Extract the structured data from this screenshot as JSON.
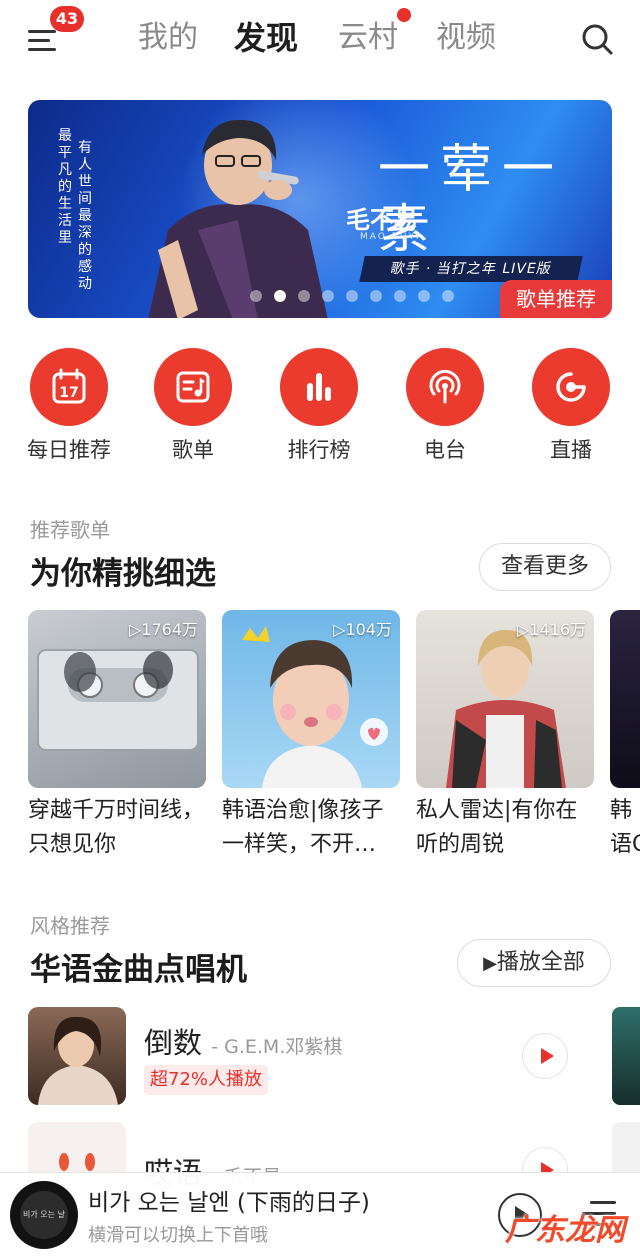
{
  "header": {
    "notification_count": "43",
    "tabs": [
      {
        "label": "我的",
        "active": false
      },
      {
        "label": "发现",
        "active": true
      },
      {
        "label": "云村",
        "active": false,
        "has_dot": true
      },
      {
        "label": "视频",
        "active": false
      }
    ],
    "icons": {
      "menu": "hamburger-icon",
      "search": "search-icon"
    }
  },
  "banner": {
    "vertical_text_1": "最平凡的生活里",
    "vertical_text_2": "有人世间最深的感动",
    "title": "一荤一素",
    "artist": "毛不易",
    "artist_en": "MAO BUYI",
    "subtitle": "歌手 · 当打之年 LIVE版",
    "tag": "歌单推荐",
    "page_count": 9,
    "current_page": 1
  },
  "quick_entries": [
    {
      "label": "每日推荐",
      "icon": "calendar-icon",
      "calendar_day": "17"
    },
    {
      "label": "歌单",
      "icon": "playlist-icon"
    },
    {
      "label": "排行榜",
      "icon": "chart-bars-icon"
    },
    {
      "label": "电台",
      "icon": "radio-icon"
    },
    {
      "label": "直播",
      "icon": "live-icon"
    }
  ],
  "recommend": {
    "subtitle": "推荐歌单",
    "title": "为你精挑细选",
    "more_label": "查看更多",
    "playlists": [
      {
        "plays": "▷1764万",
        "title": "穿越千万时间线，只想见你"
      },
      {
        "plays": "▷104万",
        "title": "韩语治愈|像孩子一样笑，不开…"
      },
      {
        "plays": "▷1416万",
        "title": "私人雷达|有你在听的周锐"
      },
      {
        "plays": "",
        "title": "韩语CU"
      }
    ]
  },
  "style": {
    "subtitle": "风格推荐",
    "title": "华语金曲点唱机",
    "play_all_label": "播放全部",
    "songs": [
      {
        "name": "倒数",
        "artist": "- G.E.M.邓紫棋",
        "tag": "超72%人播放"
      },
      {
        "name": "哎语",
        "artist": "- 毛不易",
        "tag": ""
      }
    ]
  },
  "player": {
    "title": "비가 오는 날엔 (下雨的日子)",
    "hint": "横滑可以切换上下首哦",
    "cover_text": "비가 오는 날엔"
  },
  "watermark": "广东龙网",
  "colors": {
    "accent": "#e8302a",
    "banner_blue": "#1b56d6"
  }
}
